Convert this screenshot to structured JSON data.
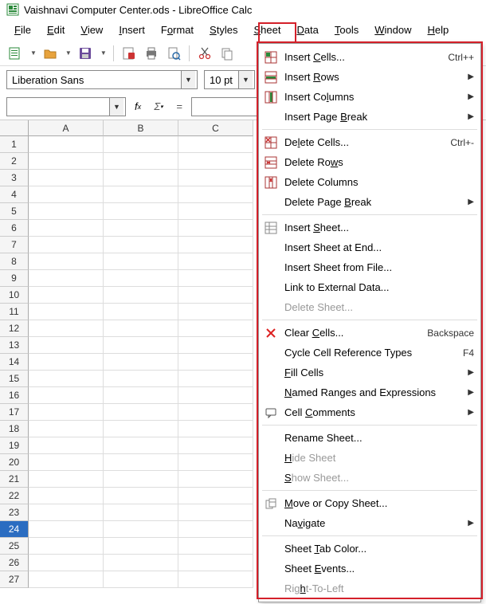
{
  "titlebar": {
    "text": "Vaishnavi Computer Center.ods - LibreOffice Calc"
  },
  "menubar": {
    "items": [
      {
        "label": "File",
        "u": 0
      },
      {
        "label": "Edit",
        "u": 0
      },
      {
        "label": "View",
        "u": 0
      },
      {
        "label": "Insert",
        "u": 0
      },
      {
        "label": "Format",
        "u": 1
      },
      {
        "label": "Styles",
        "u": 0
      },
      {
        "label": "Sheet",
        "u": 0
      },
      {
        "label": "Data",
        "u": 0
      },
      {
        "label": "Tools",
        "u": 0
      },
      {
        "label": "Window",
        "u": 0
      },
      {
        "label": "Help",
        "u": 0
      }
    ]
  },
  "fontbar": {
    "font_name": "Liberation Sans",
    "font_size": "10 pt"
  },
  "formula_bar": {
    "name_box": "",
    "formula": ""
  },
  "columns": [
    "A",
    "B",
    "C"
  ],
  "rows": [
    1,
    2,
    3,
    4,
    5,
    6,
    7,
    8,
    9,
    10,
    11,
    12,
    13,
    14,
    15,
    16,
    17,
    18,
    19,
    20,
    21,
    22,
    23,
    24,
    25,
    26,
    27
  ],
  "selected_row": 24,
  "sheet_menu": {
    "items": [
      {
        "type": "item",
        "icon": "insert-cells",
        "label": "Insert Cells...",
        "u": 7,
        "shortcut": "Ctrl++",
        "submenu": false,
        "disabled": false
      },
      {
        "type": "item",
        "icon": "insert-rows",
        "label": "Insert Rows",
        "u": 7,
        "shortcut": "",
        "submenu": true,
        "disabled": false
      },
      {
        "type": "item",
        "icon": "insert-columns",
        "label": "Insert Columns",
        "u": 9,
        "shortcut": "",
        "submenu": true,
        "disabled": false
      },
      {
        "type": "item",
        "icon": "",
        "label": "Insert Page Break",
        "u": 12,
        "shortcut": "",
        "submenu": true,
        "disabled": false
      },
      {
        "type": "sep"
      },
      {
        "type": "item",
        "icon": "delete-cells",
        "label": "Delete Cells...",
        "u": 2,
        "shortcut": "Ctrl+-",
        "submenu": false,
        "disabled": false
      },
      {
        "type": "item",
        "icon": "delete-rows",
        "label": "Delete Rows",
        "u": 9,
        "shortcut": "",
        "submenu": false,
        "disabled": false
      },
      {
        "type": "item",
        "icon": "delete-columns",
        "label": "Delete Columns",
        "u": -1,
        "shortcut": "",
        "submenu": false,
        "disabled": false
      },
      {
        "type": "item",
        "icon": "",
        "label": "Delete Page Break",
        "u": 12,
        "shortcut": "",
        "submenu": true,
        "disabled": false
      },
      {
        "type": "sep"
      },
      {
        "type": "item",
        "icon": "insert-sheet",
        "label": "Insert Sheet...",
        "u": 7,
        "shortcut": "",
        "submenu": false,
        "disabled": false
      },
      {
        "type": "item",
        "icon": "",
        "label": "Insert Sheet at End...",
        "u": -1,
        "shortcut": "",
        "submenu": false,
        "disabled": false
      },
      {
        "type": "item",
        "icon": "",
        "label": "Insert Sheet from File...",
        "u": -1,
        "shortcut": "",
        "submenu": false,
        "disabled": false
      },
      {
        "type": "item",
        "icon": "",
        "label": "Link to External Data...",
        "u": -1,
        "shortcut": "",
        "submenu": false,
        "disabled": false
      },
      {
        "type": "item",
        "icon": "",
        "label": "Delete Sheet...",
        "u": -1,
        "shortcut": "",
        "submenu": false,
        "disabled": true
      },
      {
        "type": "sep"
      },
      {
        "type": "item",
        "icon": "clear-x",
        "label": "Clear Cells...",
        "u": 6,
        "shortcut": "Backspace",
        "submenu": false,
        "disabled": false
      },
      {
        "type": "item",
        "icon": "",
        "label": "Cycle Cell Reference Types",
        "u": -1,
        "shortcut": "F4",
        "submenu": false,
        "disabled": false
      },
      {
        "type": "item",
        "icon": "",
        "label": "Fill Cells",
        "u": 0,
        "shortcut": "",
        "submenu": true,
        "disabled": false
      },
      {
        "type": "item",
        "icon": "",
        "label": "Named Ranges and Expressions",
        "u": 0,
        "shortcut": "",
        "submenu": true,
        "disabled": false
      },
      {
        "type": "item",
        "icon": "comment",
        "label": "Cell Comments",
        "u": 5,
        "shortcut": "",
        "submenu": true,
        "disabled": false
      },
      {
        "type": "sep"
      },
      {
        "type": "item",
        "icon": "",
        "label": "Rename Sheet...",
        "u": -1,
        "shortcut": "",
        "submenu": false,
        "disabled": false
      },
      {
        "type": "item",
        "icon": "",
        "label": "Hide Sheet",
        "u": 0,
        "shortcut": "",
        "submenu": false,
        "disabled": true
      },
      {
        "type": "item",
        "icon": "",
        "label": "Show Sheet...",
        "u": 0,
        "shortcut": "",
        "submenu": false,
        "disabled": true
      },
      {
        "type": "sep"
      },
      {
        "type": "item",
        "icon": "move-copy",
        "label": "Move or Copy Sheet...",
        "u": 0,
        "shortcut": "",
        "submenu": false,
        "disabled": false
      },
      {
        "type": "item",
        "icon": "",
        "label": "Navigate",
        "u": 2,
        "shortcut": "",
        "submenu": true,
        "disabled": false
      },
      {
        "type": "sep"
      },
      {
        "type": "item",
        "icon": "",
        "label": "Sheet Tab Color...",
        "u": 6,
        "shortcut": "",
        "submenu": false,
        "disabled": false
      },
      {
        "type": "item",
        "icon": "",
        "label": "Sheet Events...",
        "u": 6,
        "shortcut": "",
        "submenu": false,
        "disabled": false
      },
      {
        "type": "item",
        "icon": "",
        "label": "Right-To-Left",
        "u": 3,
        "shortcut": "",
        "submenu": false,
        "disabled": true
      }
    ]
  }
}
